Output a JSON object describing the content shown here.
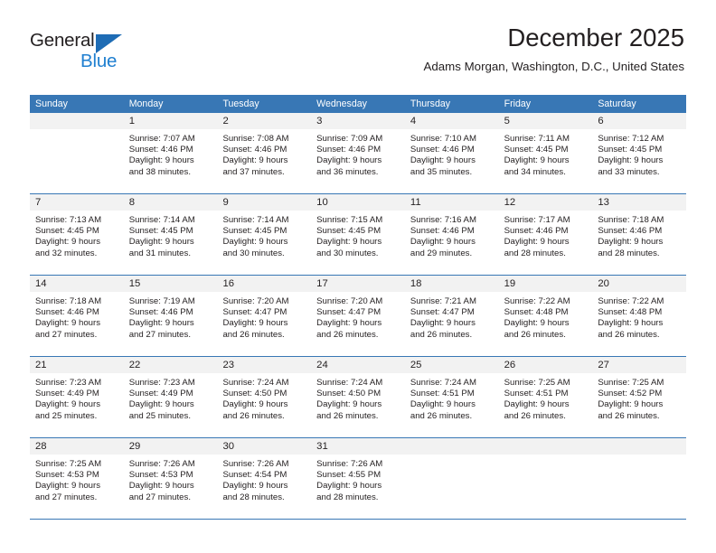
{
  "brand": {
    "name_top": "General",
    "name_bottom": "Blue",
    "triangle_icon": "triangle-icon",
    "color_dark": "#231f20",
    "color_blue": "#1f7fd0"
  },
  "header": {
    "title": "December 2025",
    "subtitle": "Adams Morgan, Washington, D.C., United States"
  },
  "theme": {
    "header_row_bg": "#3877b5",
    "header_row_text": "#ffffff",
    "day_number_band_bg": "#f2f2f2",
    "cell_bg": "#ffffff",
    "grid_line": "#3877b5",
    "text": "#231f20"
  },
  "weekdays": [
    "Sunday",
    "Monday",
    "Tuesday",
    "Wednesday",
    "Thursday",
    "Friday",
    "Saturday"
  ],
  "weeks": [
    [
      {
        "day": "",
        "lines": []
      },
      {
        "day": "1",
        "lines": [
          "Sunrise: 7:07 AM",
          "Sunset: 4:46 PM",
          "Daylight: 9 hours",
          "and 38 minutes."
        ]
      },
      {
        "day": "2",
        "lines": [
          "Sunrise: 7:08 AM",
          "Sunset: 4:46 PM",
          "Daylight: 9 hours",
          "and 37 minutes."
        ]
      },
      {
        "day": "3",
        "lines": [
          "Sunrise: 7:09 AM",
          "Sunset: 4:46 PM",
          "Daylight: 9 hours",
          "and 36 minutes."
        ]
      },
      {
        "day": "4",
        "lines": [
          "Sunrise: 7:10 AM",
          "Sunset: 4:46 PM",
          "Daylight: 9 hours",
          "and 35 minutes."
        ]
      },
      {
        "day": "5",
        "lines": [
          "Sunrise: 7:11 AM",
          "Sunset: 4:45 PM",
          "Daylight: 9 hours",
          "and 34 minutes."
        ]
      },
      {
        "day": "6",
        "lines": [
          "Sunrise: 7:12 AM",
          "Sunset: 4:45 PM",
          "Daylight: 9 hours",
          "and 33 minutes."
        ]
      }
    ],
    [
      {
        "day": "7",
        "lines": [
          "Sunrise: 7:13 AM",
          "Sunset: 4:45 PM",
          "Daylight: 9 hours",
          "and 32 minutes."
        ]
      },
      {
        "day": "8",
        "lines": [
          "Sunrise: 7:14 AM",
          "Sunset: 4:45 PM",
          "Daylight: 9 hours",
          "and 31 minutes."
        ]
      },
      {
        "day": "9",
        "lines": [
          "Sunrise: 7:14 AM",
          "Sunset: 4:45 PM",
          "Daylight: 9 hours",
          "and 30 minutes."
        ]
      },
      {
        "day": "10",
        "lines": [
          "Sunrise: 7:15 AM",
          "Sunset: 4:45 PM",
          "Daylight: 9 hours",
          "and 30 minutes."
        ]
      },
      {
        "day": "11",
        "lines": [
          "Sunrise: 7:16 AM",
          "Sunset: 4:46 PM",
          "Daylight: 9 hours",
          "and 29 minutes."
        ]
      },
      {
        "day": "12",
        "lines": [
          "Sunrise: 7:17 AM",
          "Sunset: 4:46 PM",
          "Daylight: 9 hours",
          "and 28 minutes."
        ]
      },
      {
        "day": "13",
        "lines": [
          "Sunrise: 7:18 AM",
          "Sunset: 4:46 PM",
          "Daylight: 9 hours",
          "and 28 minutes."
        ]
      }
    ],
    [
      {
        "day": "14",
        "lines": [
          "Sunrise: 7:18 AM",
          "Sunset: 4:46 PM",
          "Daylight: 9 hours",
          "and 27 minutes."
        ]
      },
      {
        "day": "15",
        "lines": [
          "Sunrise: 7:19 AM",
          "Sunset: 4:46 PM",
          "Daylight: 9 hours",
          "and 27 minutes."
        ]
      },
      {
        "day": "16",
        "lines": [
          "Sunrise: 7:20 AM",
          "Sunset: 4:47 PM",
          "Daylight: 9 hours",
          "and 26 minutes."
        ]
      },
      {
        "day": "17",
        "lines": [
          "Sunrise: 7:20 AM",
          "Sunset: 4:47 PM",
          "Daylight: 9 hours",
          "and 26 minutes."
        ]
      },
      {
        "day": "18",
        "lines": [
          "Sunrise: 7:21 AM",
          "Sunset: 4:47 PM",
          "Daylight: 9 hours",
          "and 26 minutes."
        ]
      },
      {
        "day": "19",
        "lines": [
          "Sunrise: 7:22 AM",
          "Sunset: 4:48 PM",
          "Daylight: 9 hours",
          "and 26 minutes."
        ]
      },
      {
        "day": "20",
        "lines": [
          "Sunrise: 7:22 AM",
          "Sunset: 4:48 PM",
          "Daylight: 9 hours",
          "and 26 minutes."
        ]
      }
    ],
    [
      {
        "day": "21",
        "lines": [
          "Sunrise: 7:23 AM",
          "Sunset: 4:49 PM",
          "Daylight: 9 hours",
          "and 25 minutes."
        ]
      },
      {
        "day": "22",
        "lines": [
          "Sunrise: 7:23 AM",
          "Sunset: 4:49 PM",
          "Daylight: 9 hours",
          "and 25 minutes."
        ]
      },
      {
        "day": "23",
        "lines": [
          "Sunrise: 7:24 AM",
          "Sunset: 4:50 PM",
          "Daylight: 9 hours",
          "and 26 minutes."
        ]
      },
      {
        "day": "24",
        "lines": [
          "Sunrise: 7:24 AM",
          "Sunset: 4:50 PM",
          "Daylight: 9 hours",
          "and 26 minutes."
        ]
      },
      {
        "day": "25",
        "lines": [
          "Sunrise: 7:24 AM",
          "Sunset: 4:51 PM",
          "Daylight: 9 hours",
          "and 26 minutes."
        ]
      },
      {
        "day": "26",
        "lines": [
          "Sunrise: 7:25 AM",
          "Sunset: 4:51 PM",
          "Daylight: 9 hours",
          "and 26 minutes."
        ]
      },
      {
        "day": "27",
        "lines": [
          "Sunrise: 7:25 AM",
          "Sunset: 4:52 PM",
          "Daylight: 9 hours",
          "and 26 minutes."
        ]
      }
    ],
    [
      {
        "day": "28",
        "lines": [
          "Sunrise: 7:25 AM",
          "Sunset: 4:53 PM",
          "Daylight: 9 hours",
          "and 27 minutes."
        ]
      },
      {
        "day": "29",
        "lines": [
          "Sunrise: 7:26 AM",
          "Sunset: 4:53 PM",
          "Daylight: 9 hours",
          "and 27 minutes."
        ]
      },
      {
        "day": "30",
        "lines": [
          "Sunrise: 7:26 AM",
          "Sunset: 4:54 PM",
          "Daylight: 9 hours",
          "and 28 minutes."
        ]
      },
      {
        "day": "31",
        "lines": [
          "Sunrise: 7:26 AM",
          "Sunset: 4:55 PM",
          "Daylight: 9 hours",
          "and 28 minutes."
        ]
      },
      {
        "day": "",
        "lines": []
      },
      {
        "day": "",
        "lines": []
      },
      {
        "day": "",
        "lines": []
      }
    ]
  ]
}
